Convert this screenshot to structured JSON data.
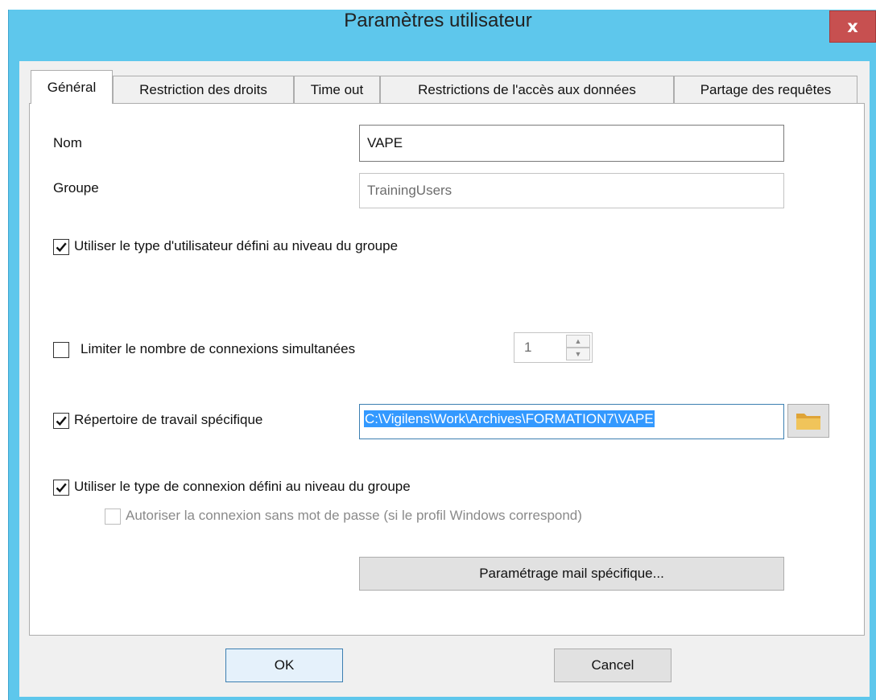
{
  "window": {
    "title": "Paramètres utilisateur",
    "close_glyph": "x"
  },
  "tabs": [
    {
      "label": "Général",
      "active": true
    },
    {
      "label": "Restriction des droits",
      "active": false
    },
    {
      "label": "Time out",
      "active": false
    },
    {
      "label": "Restrictions de l'accès aux données",
      "active": false
    },
    {
      "label": "Partage des requêtes",
      "active": false
    }
  ],
  "general": {
    "name_label": "Nom",
    "name_value": "VAPE",
    "group_label": "Groupe",
    "group_value": "TrainingUsers",
    "use_group_user_type": {
      "label": "Utiliser le type d'utilisateur défini au niveau du groupe",
      "checked": true
    },
    "limit_connections": {
      "label": "Limiter le nombre de connexions simultanées",
      "checked": false,
      "value": "1"
    },
    "work_directory": {
      "label": "Répertoire de travail spécifique",
      "checked": true,
      "path": "C:\\Vigilens\\Work\\Archives\\FORMATION7\\VAPE"
    },
    "use_group_connection_type": {
      "label": "Utiliser le type de connexion défini au niveau du groupe",
      "checked": true
    },
    "allow_passwordless": {
      "label": "Autoriser la connexion sans mot de passe (si le profil Windows correspond)",
      "checked": false,
      "enabled": false
    },
    "mail_settings_button": "Paramétrage mail spécifique..."
  },
  "footer": {
    "ok_label": "OK",
    "cancel_label": "Cancel"
  },
  "colors": {
    "titlebar": "#5ec7ec",
    "close": "#c75050",
    "selection": "#3399ff",
    "folder": "#e8b64c"
  },
  "icons": {
    "close": "close-icon",
    "folder": "folder-icon",
    "check": "checkmark-icon",
    "spin_up": "arrow-up-icon",
    "spin_down": "arrow-down-icon"
  }
}
